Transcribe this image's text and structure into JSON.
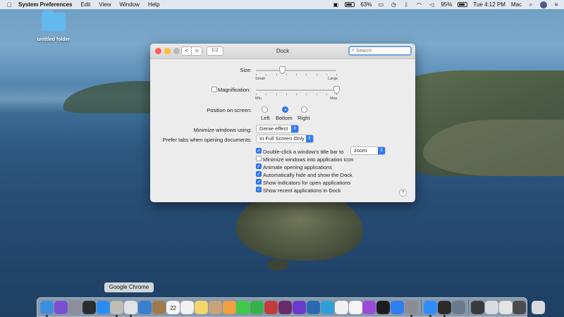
{
  "menubar": {
    "app_name": "System Preferences",
    "menus": [
      "Edit",
      "View",
      "Window",
      "Help"
    ],
    "battery_percent": "63%",
    "battery2_percent": "95%",
    "clock": "Tue 4:12 PM",
    "user": "Mac"
  },
  "desktop": {
    "folder_label": "untitled folder"
  },
  "window": {
    "title": "Dock",
    "back": "<",
    "forward": ">",
    "grid_glyph": "⠿⠿",
    "search_placeholder": "Search",
    "search_value": ""
  },
  "dock_prefs": {
    "size_label": "Size:",
    "size_min": "Small",
    "size_max": "Large",
    "size_value": 0.33,
    "magnification_label": "Magnification:",
    "magnification_checked": false,
    "mag_min": "Min",
    "mag_max": "Max",
    "mag_value": 1.0,
    "position_label": "Position on screen:",
    "position_options": [
      "Left",
      "Bottom",
      "Right"
    ],
    "position_selected": "Bottom",
    "minimize_label": "Minimize windows using:",
    "minimize_value": "Genie effect",
    "prefer_tabs_label": "Prefer tabs when opening documents:",
    "prefer_tabs_value": "In Full Screen Only",
    "double_click_label": "Double-click a window's title bar to",
    "double_click_value": "zoom",
    "checkboxes": [
      {
        "label": "Double-click a window's title bar to",
        "checked": true
      },
      {
        "label": "Minimize windows into application icon",
        "checked": false
      },
      {
        "label": "Animate opening applications",
        "checked": true
      },
      {
        "label": "Automatically hide and show the Dock",
        "checked": true
      },
      {
        "label": "Show indicators for open applications",
        "checked": true
      },
      {
        "label": "Show recent applications in Dock",
        "checked": true
      }
    ],
    "help": "?"
  },
  "tooltip": "Google Chrome",
  "dock": {
    "calendar_day": "22",
    "icons": [
      {
        "name": "finder-icon",
        "color": "#3d8de0",
        "running": true
      },
      {
        "name": "siri-icon",
        "color": "#7a4fd0",
        "running": false
      },
      {
        "name": "launchpad-icon",
        "color": "#8a8f99",
        "running": false
      },
      {
        "name": "activity-monitor-icon",
        "color": "#2a2d2f",
        "running": false
      },
      {
        "name": "safari-icon",
        "color": "#2c8df0",
        "running": false
      },
      {
        "name": "notes-app-icon",
        "color": "#bfbfb8",
        "running": true
      },
      {
        "name": "chrome-icon",
        "color": "#e0e4e8",
        "running": true
      },
      {
        "name": "preview-icon",
        "color": "#3a7fd0",
        "running": false
      },
      {
        "name": "notebook-icon",
        "color": "#a07a4a",
        "running": false
      },
      {
        "name": "calendar-icon",
        "color": "#f6f6f6",
        "running": false
      },
      {
        "name": "reminders-icon",
        "color": "#f1f1f1",
        "running": false
      },
      {
        "name": "stickies-icon",
        "color": "#f4d76a",
        "running": false
      },
      {
        "name": "contacts-icon",
        "color": "#c8a37a",
        "running": false
      },
      {
        "name": "photos-icon",
        "color": "#f0a040",
        "running": false
      },
      {
        "name": "messages-icon",
        "color": "#3fc94a",
        "running": false
      },
      {
        "name": "facetime-icon",
        "color": "#37b24a",
        "running": false
      },
      {
        "name": "photo-booth-icon",
        "color": "#c33b3b",
        "running": false
      },
      {
        "name": "video-icon",
        "color": "#6a2a6a",
        "running": false
      },
      {
        "name": "imovie-icon",
        "color": "#6a3acb",
        "running": false
      },
      {
        "name": "screen-icon",
        "color": "#2a6ab0",
        "running": false
      },
      {
        "name": "web-icon",
        "color": "#2f9fd6",
        "running": false
      },
      {
        "name": "news-icon",
        "color": "#f0f0f0",
        "running": false
      },
      {
        "name": "music-icon",
        "color": "#f5f5f5",
        "running": false
      },
      {
        "name": "podcasts-icon",
        "color": "#9b4ad8",
        "running": false
      },
      {
        "name": "tv-icon",
        "color": "#1c1c1c",
        "running": false
      },
      {
        "name": "app-store-icon",
        "color": "#2f7ef0",
        "running": false
      },
      {
        "name": "system-preferences-icon",
        "color": "#8a8d93",
        "running": true
      },
      {
        "name": "zoom-icon",
        "color": "#2d8cff",
        "running": true
      },
      {
        "name": "terminal-icon",
        "color": "#2a2a2a",
        "running": true
      },
      {
        "name": "app-window-icon",
        "color": "#6a7a8c",
        "running": false
      },
      {
        "name": "recent-1-icon",
        "color": "#3a3a3a",
        "running": false
      },
      {
        "name": "recent-2-icon",
        "color": "#d8dce2",
        "running": false
      },
      {
        "name": "recent-3-icon",
        "color": "#e4e4e4",
        "running": false
      },
      {
        "name": "recent-4-icon",
        "color": "#4b4b4b",
        "running": false
      },
      {
        "name": "trash-icon",
        "color": "#d8dadd",
        "running": false
      }
    ]
  }
}
